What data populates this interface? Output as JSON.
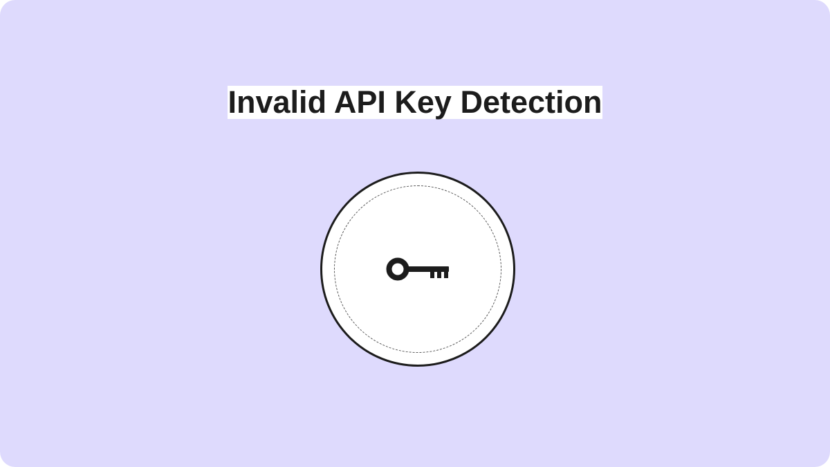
{
  "title": "Invalid API Key Detection",
  "colors": {
    "background": "#dedafd",
    "card_surface": "#ffffff",
    "ink": "#1c1c1c"
  },
  "icon": "key-icon"
}
